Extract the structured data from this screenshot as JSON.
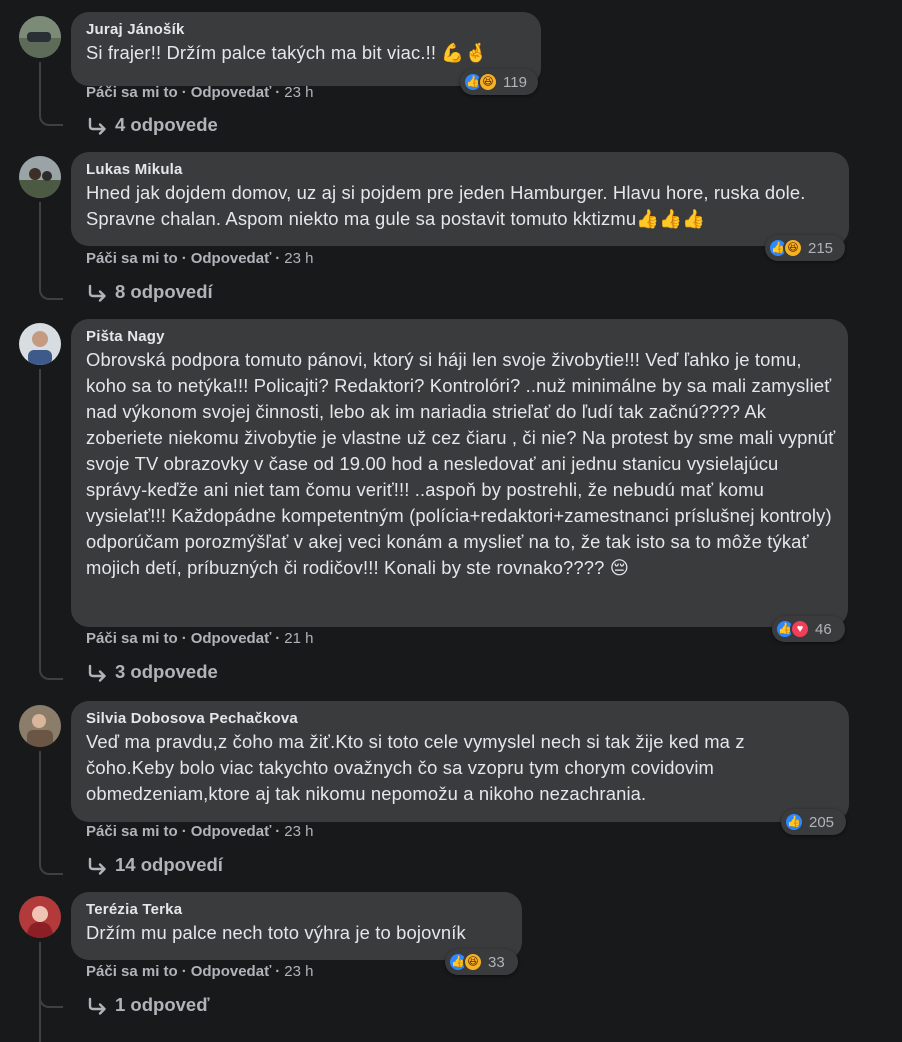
{
  "colors": {
    "background": "#18191a",
    "bubble": "#3a3b3c",
    "text": "#e4e6eb",
    "secondary": "#b0b3b8",
    "like": "#2d88ff",
    "haha": "#f7b125",
    "love": "#f33e58"
  },
  "action_labels": {
    "like": "Páči sa mi to",
    "reply": "Odpovedať"
  },
  "comments": [
    {
      "author": "Juraj Jánošík",
      "text": "Si frajer!! Držím palce takých ma bit viac.!! 💪🤞",
      "reaction_icons": [
        "like",
        "haha"
      ],
      "reaction_count": "119",
      "time": "23 h",
      "replies_label": "4 odpovede"
    },
    {
      "author": "Lukas Mikula",
      "text": "Hned jak dojdem domov, uz aj si pojdem pre jeden Hamburger. Hlavu hore, ruska dole. Spravne chalan. Aspom niekto ma gule sa postavit tomuto kktizmu👍👍👍",
      "reaction_icons": [
        "like",
        "haha"
      ],
      "reaction_count": "215",
      "time": "23 h",
      "replies_label": "8 odpovedí"
    },
    {
      "author": "Pišta Nagy",
      "text": "Obrovská podpora tomuto pánovi, ktorý si háji len svoje živobytie!!! Veď ľahko je tomu, koho sa to netýka!!! Policajti? Redaktori? Kontrolóri? ..nuž minimálne by sa mali zamyslieť nad výkonom svojej činnosti, lebo ak im nariadia strieľať do ľudí tak začnú???? Ak zoberiete niekomu živobytie je vlastne už cez čiaru , či nie? Na protest by sme mali vypnúť svoje TV obrazovky v čase od 19.00 hod a nesledovať ani jednu stanicu vysielajúcu správy-keďže ani niet tam čomu veriť!!! ..aspoň by postrehli, že nebudú mať komu vysielať!!! Každopádne kompetentným (polícia+redaktori+zamestnanci príslušnej kontroly) odporúčam porozmýšľať v akej veci konám a myslieť na to, že tak isto sa to môže týkať mojich detí, príbuzných či rodičov!!! Konali by ste rovnako???? 😔",
      "reaction_icons": [
        "like",
        "love"
      ],
      "reaction_count": "46",
      "time": "21 h",
      "replies_label": "3 odpovede"
    },
    {
      "author": "Silvia Dobosova Pechačkova",
      "text": "Veď ma pravdu,z čoho ma žiť.Kto si toto cele vymyslel nech si tak žije ked ma z čoho.Keby bolo viac takychto ovažnych čo sa vzopru tym chorym covidovim obmedzeniam,ktore aj tak nikomu nepomožu a nikoho nezachrania.",
      "reaction_icons": [
        "like"
      ],
      "reaction_count": "205",
      "time": "23 h",
      "replies_label": "14 odpovedí"
    },
    {
      "author": "Terézia Terka",
      "text": "Držím mu palce nech toto výhra je to bojovník",
      "reaction_icons": [
        "like",
        "haha"
      ],
      "reaction_count": "33",
      "time": "23 h",
      "replies_label": "1 odpoveď"
    }
  ]
}
